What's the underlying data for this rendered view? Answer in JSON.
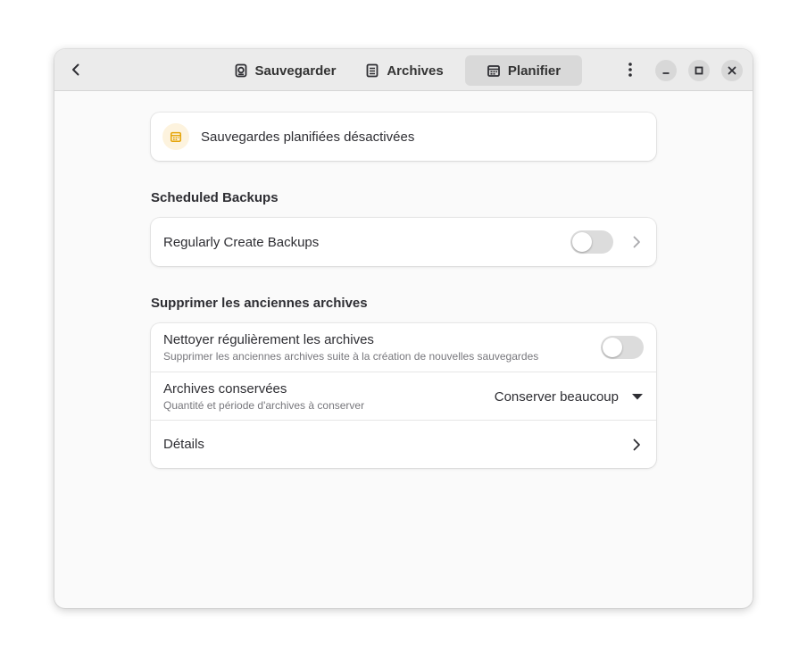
{
  "header": {
    "tabs": [
      {
        "label": "Sauvegarder",
        "icon": "backup-icon",
        "active": false
      },
      {
        "label": "Archives",
        "icon": "archives-icon",
        "active": false
      },
      {
        "label": "Planifier",
        "icon": "calendar-icon",
        "active": true
      }
    ]
  },
  "status": {
    "text": "Sauvegardes planifiées désactivées",
    "icon": "calendar-icon",
    "icon_color": "#e5a50a"
  },
  "scheduled": {
    "title": "Scheduled Backups",
    "regular_label": "Regularly Create Backups",
    "regular_enabled": false
  },
  "prune": {
    "title": "Supprimer les anciennes archives",
    "cleanup_title": "Nettoyer régulièrement les archives",
    "cleanup_subtitle": "Supprimer les anciennes archives suite à la création de nouvelles sauvegardes",
    "cleanup_enabled": false,
    "kept_title": "Archives conservées",
    "kept_subtitle": "Quantité et période d'archives à conserver",
    "kept_value": "Conserver beaucoup",
    "details_label": "Détails"
  },
  "colors": {
    "accent": "#e5a50a",
    "toggle_off": "#dcdcdc",
    "active_tab": "#d9d9d9"
  }
}
